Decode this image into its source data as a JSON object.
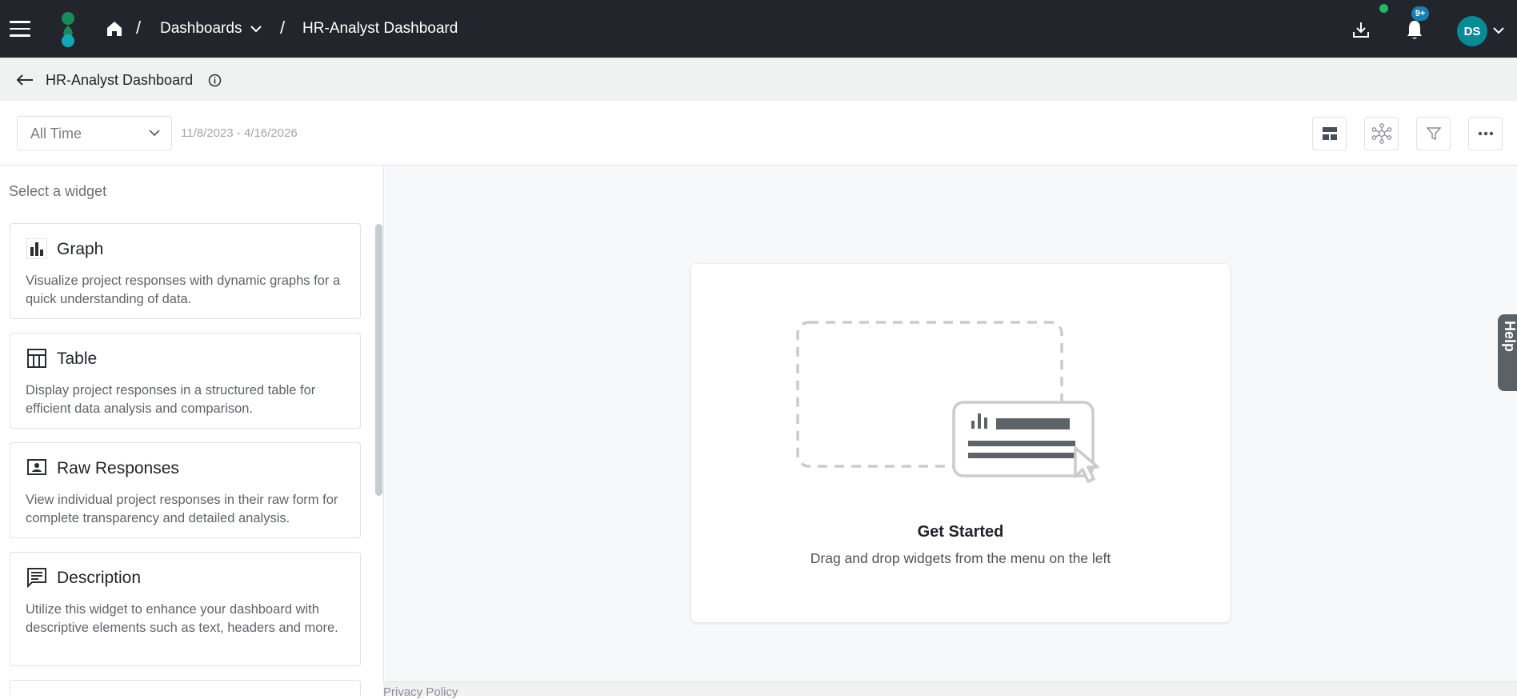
{
  "topbar": {
    "breadcrumb": [
      {
        "label": "Dashboards"
      },
      {
        "label": "HR-Analyst Dashboard"
      }
    ],
    "notifications_badge": "9+",
    "avatar_initials": "DS"
  },
  "subbar": {
    "title": "HR-Analyst Dashboard"
  },
  "filters": {
    "time_range": "All Time",
    "date_range": "11/8/2023 - 4/16/2026"
  },
  "sidebar": {
    "title": "Select a widget",
    "widgets": [
      {
        "title": "Graph",
        "icon": "bar-chart-icon",
        "description": "Visualize project responses with dynamic graphs for a quick understanding of data."
      },
      {
        "title": "Table",
        "icon": "table-icon",
        "description": "Display project responses in a structured table for efficient data analysis and comparison."
      },
      {
        "title": "Raw Responses",
        "icon": "contact-card-icon",
        "description": "View individual project responses in their raw form for complete transparency and detailed analysis."
      },
      {
        "title": "Description",
        "icon": "text-lines-icon",
        "description": "Utilize this widget to enhance your dashboard with descriptive elements such as text, headers and more."
      }
    ]
  },
  "main": {
    "empty_title": "Get Started",
    "empty_desc": "Drag and drop widgets from the menu on the left"
  },
  "help_tab": "Help",
  "footer": {
    "privacy": "Privacy Policy"
  },
  "colors": {
    "topbar_bg": "#22262c",
    "avatar_bg": "#0a8a94",
    "badge_bg": "#1a7fb0",
    "status_dot": "#1db86a"
  }
}
